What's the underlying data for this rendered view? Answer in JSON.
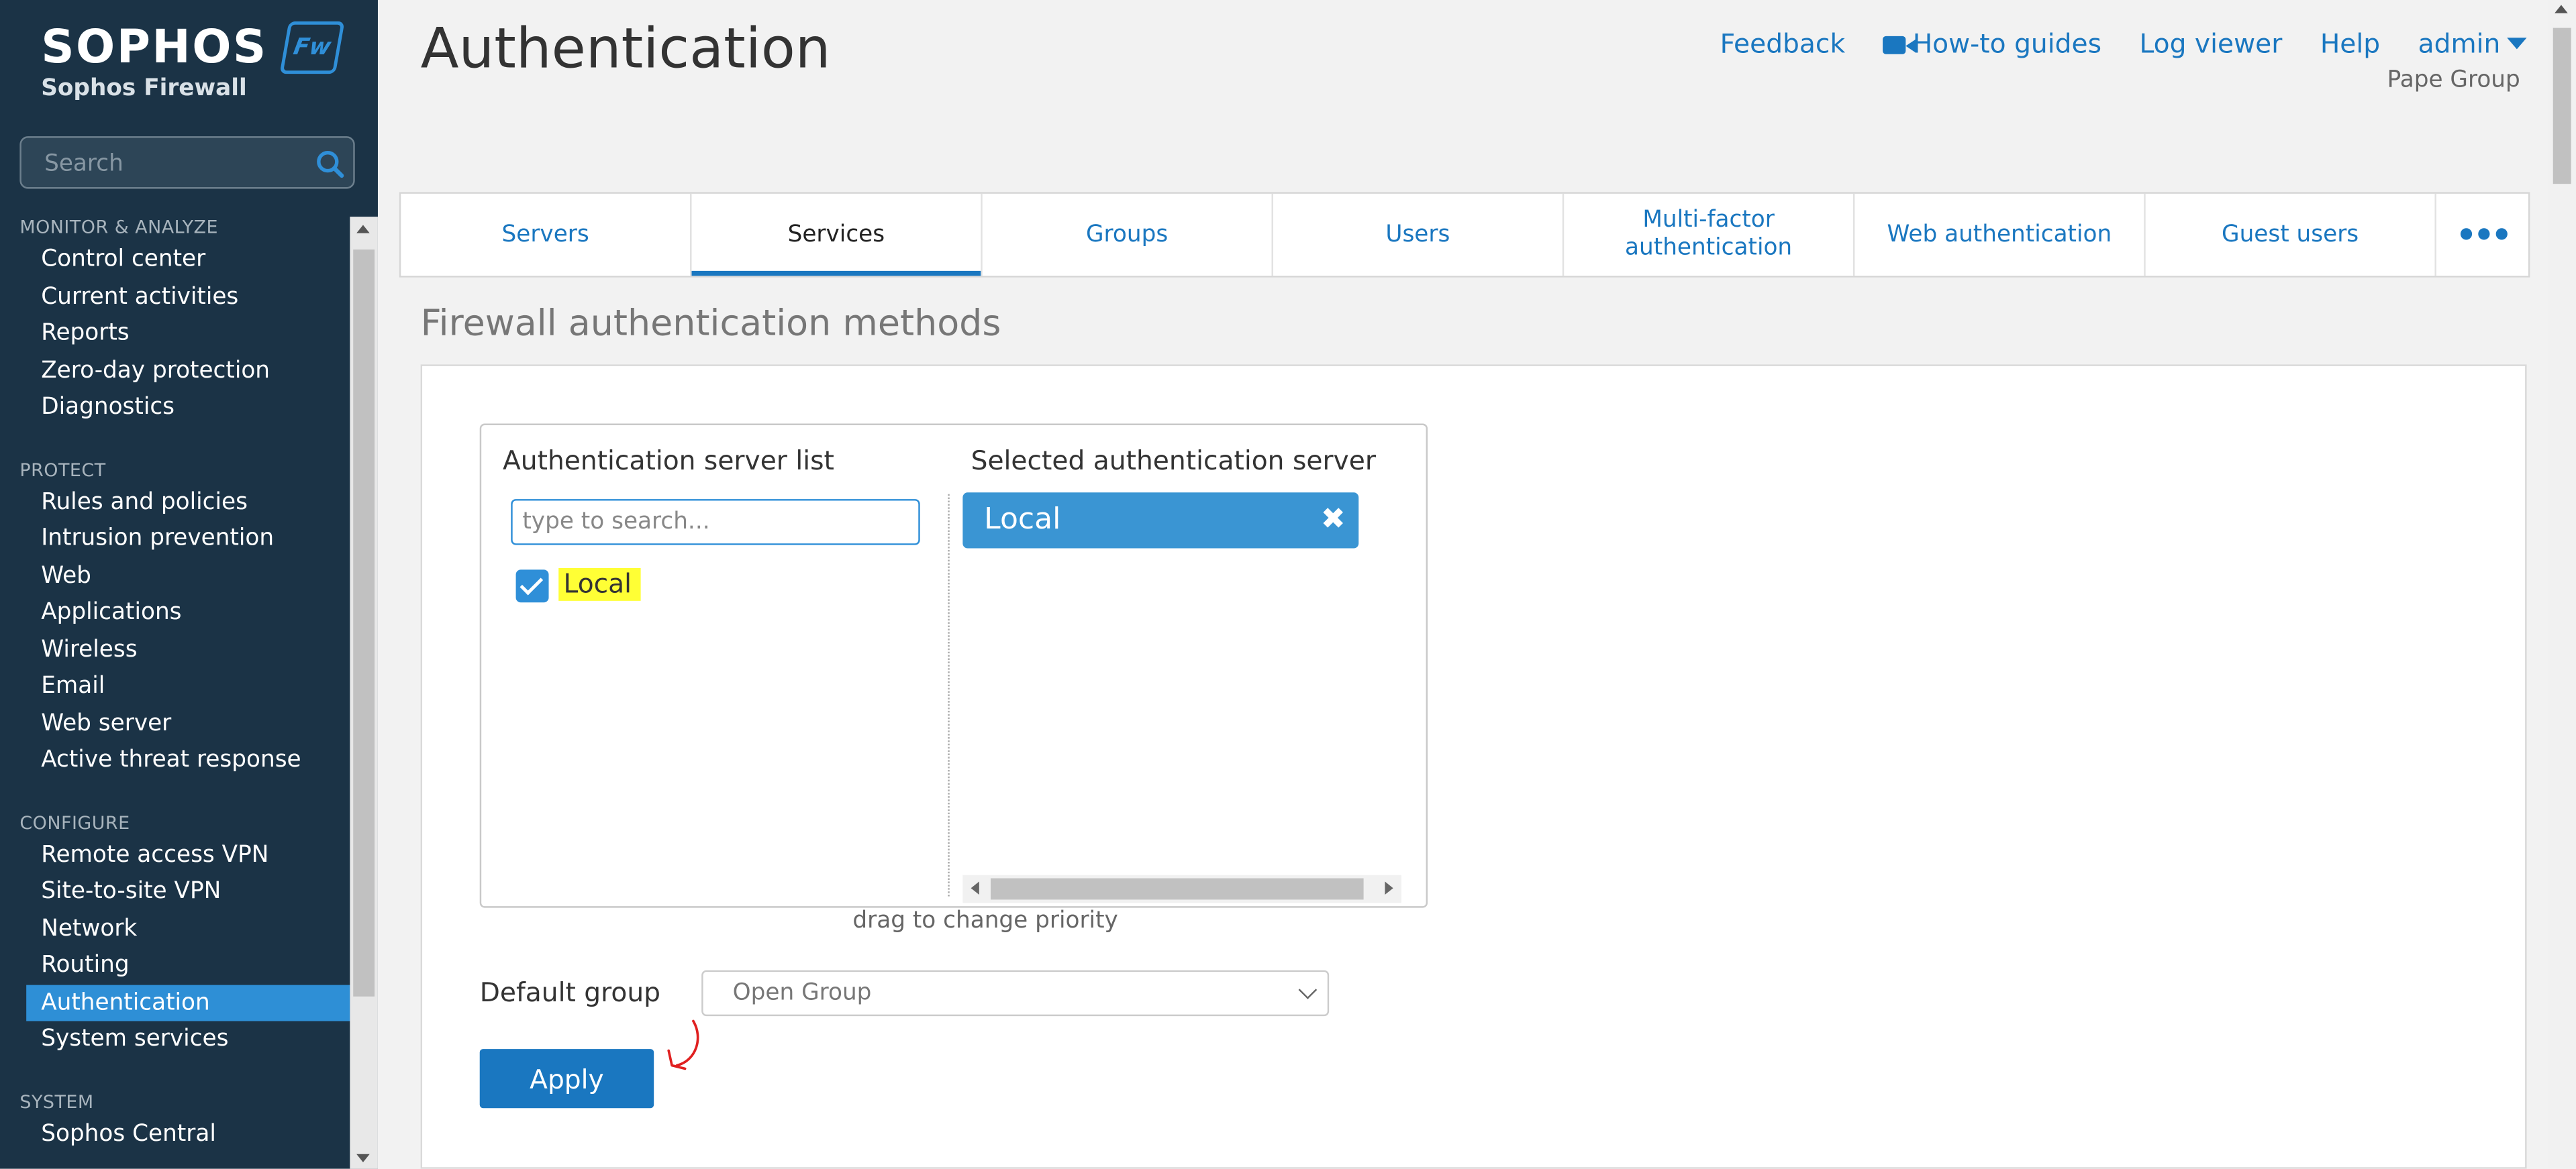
{
  "brand": {
    "logo_text": "SOPHOS",
    "badge": "Fw",
    "product": "Sophos Firewall"
  },
  "sidebar": {
    "search_placeholder": "Search",
    "sections": [
      {
        "title": "MONITOR & ANALYZE",
        "items": [
          "Control center",
          "Current activities",
          "Reports",
          "Zero-day protection",
          "Diagnostics"
        ]
      },
      {
        "title": "PROTECT",
        "items": [
          "Rules and policies",
          "Intrusion prevention",
          "Web",
          "Applications",
          "Wireless",
          "Email",
          "Web server",
          "Active threat response"
        ]
      },
      {
        "title": "CONFIGURE",
        "items": [
          "Remote access VPN",
          "Site-to-site VPN",
          "Network",
          "Routing",
          "Authentication",
          "System services"
        ]
      },
      {
        "title": "SYSTEM",
        "items": [
          "Sophos Central"
        ]
      }
    ],
    "active_item": "Authentication"
  },
  "header": {
    "title": "Authentication",
    "links": {
      "feedback": "Feedback",
      "howto": "How-to guides",
      "logviewer": "Log viewer",
      "help": "Help",
      "user": "admin"
    },
    "org": "Pape Group"
  },
  "tabs": {
    "servers": "Servers",
    "services": "Services",
    "groups": "Groups",
    "users": "Users",
    "mfa": "Multi-factor authentication",
    "webauth": "Web authentication",
    "guest": "Guest users",
    "more": "•••",
    "active": "Services"
  },
  "main": {
    "section_title": "Firewall authentication methods",
    "server_list_title": "Authentication server list",
    "selected_title": "Selected authentication server",
    "search_placeholder": "type to search...",
    "available_item": "Local",
    "available_checked": true,
    "selected_item": "Local",
    "remove_glyph": "✖",
    "hint": "drag to change priority",
    "default_group_label": "Default group",
    "default_group_value": "Open Group",
    "apply_label": "Apply"
  },
  "colors": {
    "sidebar_bg": "#1b3346",
    "accent": "#1a77c0",
    "highlight": "#ffff35",
    "annotation": "#e02020"
  },
  "icons": {
    "search": "search-icon",
    "camera": "video-camera-icon",
    "caret": "caret-down-icon",
    "remove": "close-icon",
    "checkbox": "checkbox-checked-icon",
    "chevron": "chevron-down-icon",
    "annotation": "red-arrow-annotation"
  }
}
